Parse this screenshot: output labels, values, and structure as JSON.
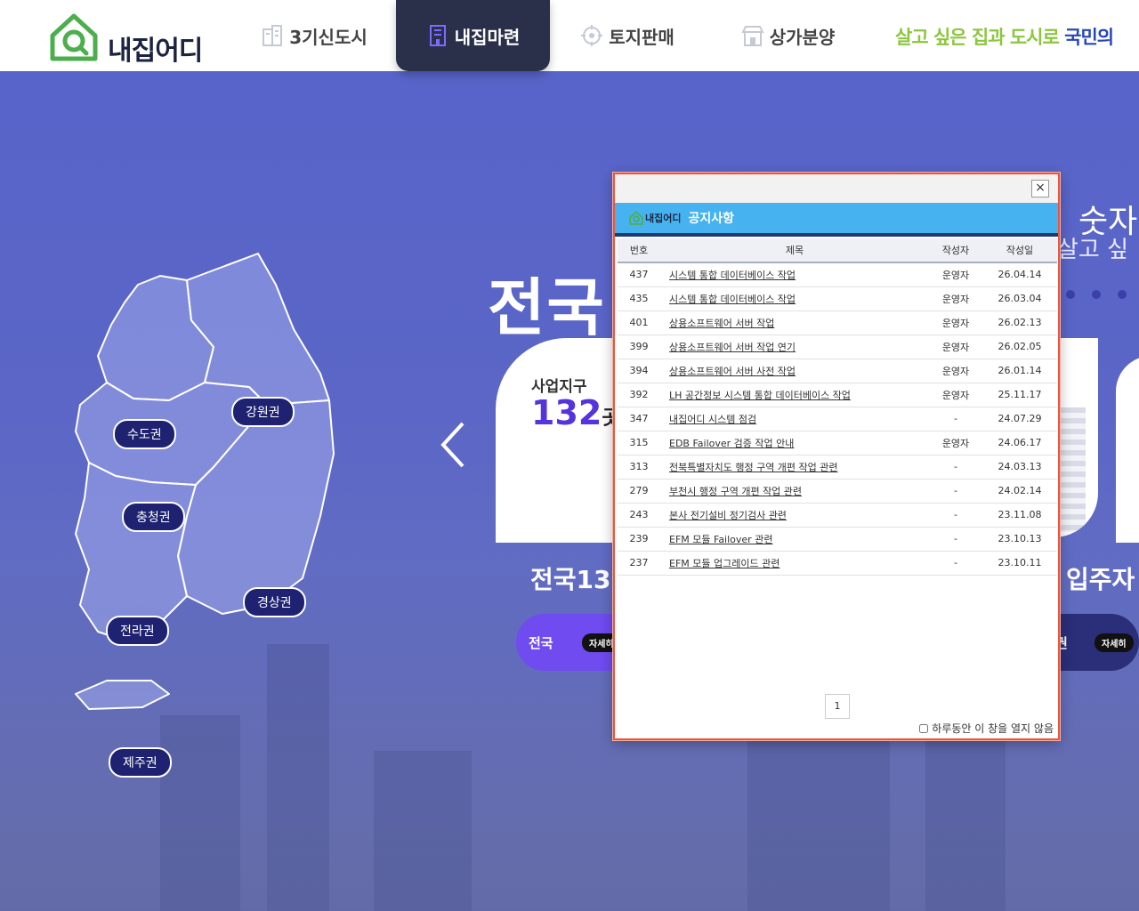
{
  "header": {
    "logo_text": "내집어디",
    "nav": [
      {
        "label": "3기신도시",
        "icon": "building-icon"
      },
      {
        "label": "내집마련",
        "icon": "apartment-icon",
        "active": true
      },
      {
        "label": "토지판매",
        "icon": "target-icon"
      },
      {
        "label": "상가분양",
        "icon": "store-icon"
      }
    ],
    "slogan_green": "살고 싶은 집과 도시로 ",
    "slogan_blue": "국민의"
  },
  "map": {
    "regions": [
      "수도권",
      "강원권",
      "충청권",
      "경상권",
      "전라권",
      "제주권"
    ]
  },
  "hero": {
    "title": "전국",
    "right_title": "숫자",
    "right_subtitle": "살고 싶",
    "card": {
      "label": "사업지구",
      "count": "132",
      "unit": "곳"
    },
    "caption_left": "전국13",
    "caption_right": "입주자",
    "pill_left_label": "전국",
    "pill_button": "자세히",
    "pill_right_label": "권",
    "pill_right_button": "자세히"
  },
  "popup": {
    "brand": "내집어디",
    "title": "공지사항",
    "close_label": "×",
    "columns": [
      "번호",
      "제목",
      "작성자",
      "작성일"
    ],
    "rows": [
      {
        "no": "437",
        "title": "시스템 통합 데이터베이스 작업",
        "author": "운영자",
        "date": "26.04.14"
      },
      {
        "no": "435",
        "title": "시스템 통합 데이터베이스 작업",
        "author": "운영자",
        "date": "26.03.04"
      },
      {
        "no": "401",
        "title": "상용소프트웨어 서버 작업",
        "author": "운영자",
        "date": "26.02.13"
      },
      {
        "no": "399",
        "title": "상용소프트웨어 서버 작업 연기",
        "author": "운영자",
        "date": "26.02.05"
      },
      {
        "no": "394",
        "title": "상용소프트웨어 서버 사전 작업",
        "author": "운영자",
        "date": "26.01.14"
      },
      {
        "no": "392",
        "title": "LH 공간정보 시스템 통합 데이터베이스 작업",
        "author": "운영자",
        "date": "25.11.17"
      },
      {
        "no": "347",
        "title": "내집어디 시스템 점검",
        "author": "-",
        "date": "24.07.29"
      },
      {
        "no": "315",
        "title": "EDB Failover 검증 작업 안내",
        "author": "운영자",
        "date": "24.06.17"
      },
      {
        "no": "313",
        "title": "전북특별자치도 행정 구역 개편 작업 관련",
        "author": "-",
        "date": "24.03.13"
      },
      {
        "no": "279",
        "title": "부천시 행정 구역 개편 작업 관련",
        "author": "-",
        "date": "24.02.14"
      },
      {
        "no": "243",
        "title": "본사 전기설비 정기검사 관련",
        "author": "-",
        "date": "23.11.08"
      },
      {
        "no": "239",
        "title": "EFM 모듈 Failover 관련",
        "author": "-",
        "date": "23.10.13"
      },
      {
        "no": "237",
        "title": "EFM 모듈 업그레이드 관련",
        "author": "-",
        "date": "23.10.11"
      }
    ],
    "page": "1",
    "dont_show_label": "하루동안 이 창을 열지 않음"
  },
  "colors": {
    "accent_green": "#8cc63f",
    "nav_active_bg": "#2a2f4a",
    "popup_header": "#46b3f0",
    "popup_border": "#e9553c",
    "hero_bg": "#5a63c4"
  }
}
